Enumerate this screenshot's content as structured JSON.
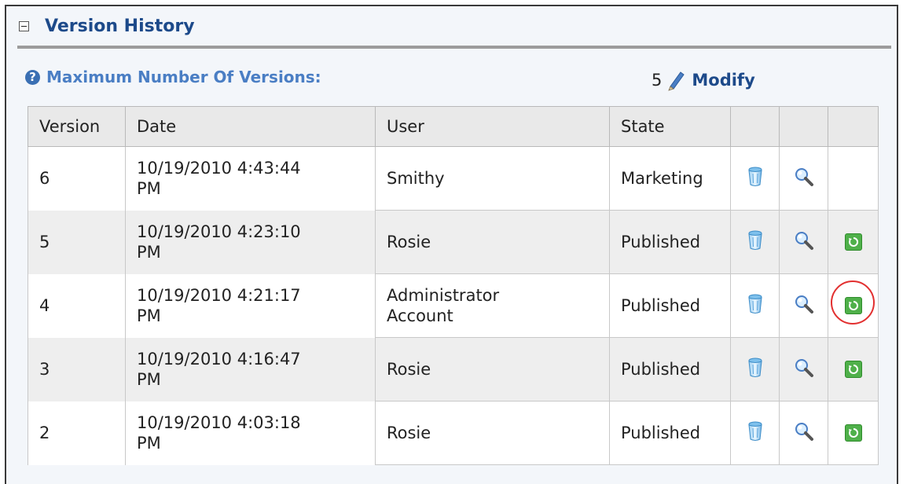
{
  "panel": {
    "title": "Version History",
    "max_versions_label": "Maximum Number Of Versions:",
    "max_versions_value": "5",
    "modify_label": "Modify"
  },
  "table": {
    "headers": [
      "Version",
      "Date",
      "User",
      "State",
      "",
      "",
      ""
    ],
    "rows": [
      {
        "version": "6",
        "date_line1": "10/19/2010 4:43:44",
        "date_line2": "PM",
        "user_line1": "Smithy",
        "user_line2": "",
        "state": "Marketing",
        "restore": false
      },
      {
        "version": "5",
        "date_line1": "10/19/2010 4:23:10",
        "date_line2": "PM",
        "user_line1": "Rosie",
        "user_line2": "",
        "state": "Published",
        "restore": true
      },
      {
        "version": "4",
        "date_line1": "10/19/2010 4:21:17",
        "date_line2": "PM",
        "user_line1": "Administrator",
        "user_line2": "Account",
        "state": "Published",
        "restore": true,
        "highlighted": true
      },
      {
        "version": "3",
        "date_line1": "10/19/2010 4:16:47",
        "date_line2": "PM",
        "user_line1": "Rosie",
        "user_line2": "",
        "state": "Published",
        "restore": true
      },
      {
        "version": "2",
        "date_line1": "10/19/2010 4:03:18",
        "date_line2": "PM",
        "user_line1": "Rosie",
        "user_line2": "",
        "state": "Published",
        "restore": true
      }
    ]
  },
  "icons": {
    "collapse": "collapse-icon",
    "help": "help-icon",
    "edit": "pencil-icon",
    "delete": "trash-icon",
    "view": "magnifier-icon",
    "restore": "restore-icon"
  },
  "colors": {
    "title": "#1d4a8a",
    "label": "#4a7ec4",
    "restore_green": "#4fb04a",
    "highlight_ring": "#e23030"
  }
}
